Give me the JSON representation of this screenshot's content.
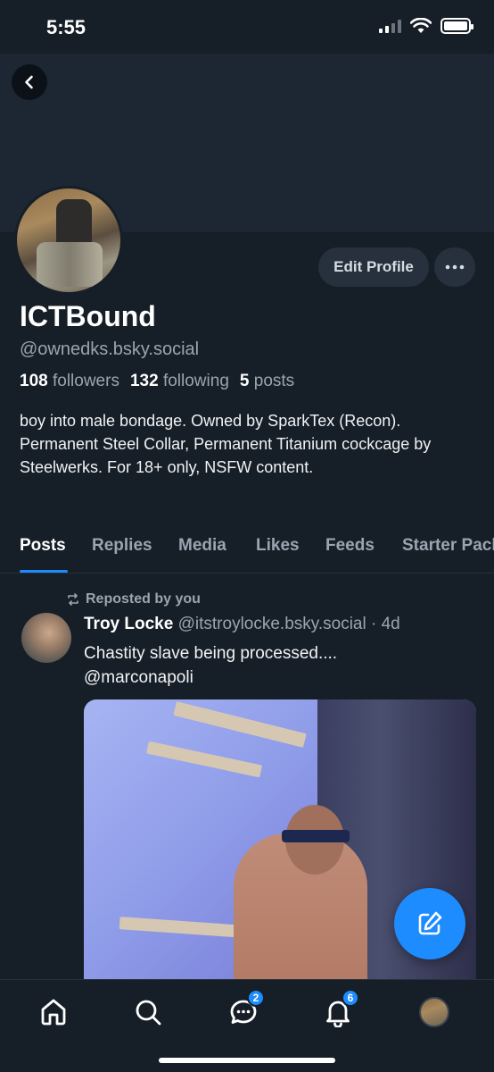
{
  "status_bar": {
    "time": "5:55"
  },
  "profile": {
    "display_name": "ICTBound",
    "handle": "@ownedks.bsky.social",
    "followers_count": "108",
    "followers_label": "followers",
    "following_count": "132",
    "following_label": "following",
    "posts_count": "5",
    "posts_label": "posts",
    "bio": "boy into male bondage. Owned by SparkTex (Recon). Permanent Steel Collar, Permanent Titanium cockcage by Steelwerks.  For 18+ only, NSFW content.",
    "edit_profile_label": "Edit Profile"
  },
  "tabs": [
    "Posts",
    "Replies",
    "Media",
    "Likes",
    "Feeds",
    "Starter Packs"
  ],
  "active_tab": "Posts",
  "post": {
    "repost_label": "Reposted by you",
    "author": "Troy Locke",
    "author_handle": "@itstroylocke.bsky.social",
    "time": "· 4d",
    "text_line1": "Chastity slave being processed....",
    "text_line2": "@marconapoli"
  },
  "nav": {
    "chat_badge": "2",
    "notifications_badge": "6"
  },
  "colors": {
    "accent": "#1d8cff",
    "background": "#161e27"
  }
}
